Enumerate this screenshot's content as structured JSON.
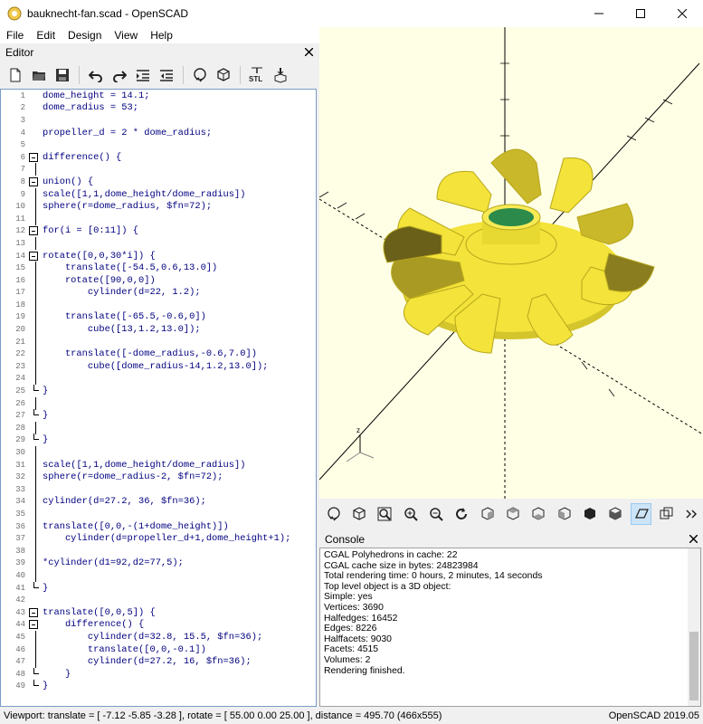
{
  "window": {
    "title": "bauknecht-fan.scad - OpenSCAD",
    "controls": [
      "minimize-icon",
      "maximize-icon",
      "close-icon"
    ]
  },
  "menu": [
    "File",
    "Edit",
    "Design",
    "View",
    "Help"
  ],
  "editor": {
    "title": "Editor",
    "toolbar_icons": [
      "new-file-icon",
      "open-file-icon",
      "save-icon",
      "undo-icon",
      "redo-icon",
      "indent-icon",
      "unindent-icon",
      "preview-icon",
      "render-icon",
      "export-stl-icon",
      "send-to-print-icon"
    ],
    "lines": [
      {
        "n": "1",
        "fold": "",
        "text": "dome_height = 14.1;"
      },
      {
        "n": "2",
        "fold": "",
        "text": "dome_radius = 53;"
      },
      {
        "n": "3",
        "fold": "",
        "text": ""
      },
      {
        "n": "4",
        "fold": "",
        "text": "propeller_d = 2 * dome_radius;"
      },
      {
        "n": "5",
        "fold": "",
        "text": ""
      },
      {
        "n": "6",
        "fold": "open",
        "text": "difference() {"
      },
      {
        "n": "7",
        "fold": "line",
        "text": ""
      },
      {
        "n": "8",
        "fold": "open",
        "text": "union() {"
      },
      {
        "n": "9",
        "fold": "line",
        "text": "scale([1,1,dome_height/dome_radius])"
      },
      {
        "n": "10",
        "fold": "line",
        "text": "sphere(r=dome_radius, $fn=72);"
      },
      {
        "n": "11",
        "fold": "line",
        "text": ""
      },
      {
        "n": "12",
        "fold": "open",
        "text": "for(i = [0:11]) {"
      },
      {
        "n": "13",
        "fold": "line",
        "text": ""
      },
      {
        "n": "14",
        "fold": "open",
        "text": "rotate([0,0,30*i]) {"
      },
      {
        "n": "15",
        "fold": "line",
        "text": "    translate([-54.5,0.6,13.0])"
      },
      {
        "n": "16",
        "fold": "line",
        "text": "    rotate([90,0,0])"
      },
      {
        "n": "17",
        "fold": "line",
        "text": "        cylinder(d=22, 1.2);"
      },
      {
        "n": "18",
        "fold": "line",
        "text": ""
      },
      {
        "n": "19",
        "fold": "line",
        "text": "    translate([-65.5,-0.6,0])"
      },
      {
        "n": "20",
        "fold": "line",
        "text": "        cube([13,1.2,13.0]);"
      },
      {
        "n": "21",
        "fold": "line",
        "text": ""
      },
      {
        "n": "22",
        "fold": "line",
        "text": "    translate([-dome_radius,-0.6,7.0])"
      },
      {
        "n": "23",
        "fold": "line",
        "text": "        cube([dome_radius-14,1.2,13.0]);"
      },
      {
        "n": "24",
        "fold": "line",
        "text": ""
      },
      {
        "n": "25",
        "fold": "end",
        "text": "}"
      },
      {
        "n": "26",
        "fold": "line",
        "text": ""
      },
      {
        "n": "27",
        "fold": "end",
        "text": "}"
      },
      {
        "n": "28",
        "fold": "line",
        "text": ""
      },
      {
        "n": "29",
        "fold": "end",
        "text": "}"
      },
      {
        "n": "30",
        "fold": "line",
        "text": ""
      },
      {
        "n": "31",
        "fold": "line",
        "text": "scale([1,1,dome_height/dome_radius])"
      },
      {
        "n": "32",
        "fold": "line",
        "text": "sphere(r=dome_radius-2, $fn=72);"
      },
      {
        "n": "33",
        "fold": "line",
        "text": ""
      },
      {
        "n": "34",
        "fold": "line",
        "text": "cylinder(d=27.2, 36, $fn=36);"
      },
      {
        "n": "35",
        "fold": "line",
        "text": ""
      },
      {
        "n": "36",
        "fold": "line",
        "text": "translate([0,0,-(1+dome_height)])"
      },
      {
        "n": "37",
        "fold": "line",
        "text": "    cylinder(d=propeller_d+1,dome_height+1);"
      },
      {
        "n": "38",
        "fold": "line",
        "text": ""
      },
      {
        "n": "39",
        "fold": "line",
        "text": "*cylinder(d1=92,d2=77,5);"
      },
      {
        "n": "40",
        "fold": "line",
        "text": ""
      },
      {
        "n": "41",
        "fold": "end",
        "text": "}"
      },
      {
        "n": "42",
        "fold": "",
        "text": ""
      },
      {
        "n": "43",
        "fold": "open",
        "text": "translate([0,0,5]) {"
      },
      {
        "n": "44",
        "fold": "open",
        "text": "    difference() {"
      },
      {
        "n": "45",
        "fold": "line",
        "text": "        cylinder(d=32.8, 15.5, $fn=36);"
      },
      {
        "n": "46",
        "fold": "line",
        "text": "        translate([0,0,-0.1])"
      },
      {
        "n": "47",
        "fold": "line",
        "text": "        cylinder(d=27.2, 16, $fn=36);"
      },
      {
        "n": "48",
        "fold": "end",
        "text": "    }"
      },
      {
        "n": "49",
        "fold": "end",
        "text": "}"
      }
    ]
  },
  "viewport": {
    "background": "#ffffe5",
    "model_color": "#f3e33a",
    "axis_label": "z"
  },
  "view_toolbar_icons": [
    "preview-icon",
    "render-icon",
    "zoom-all-icon",
    "zoom-in-icon",
    "zoom-out-icon",
    "reset-view-icon",
    "view-right-icon",
    "view-top-icon",
    "view-bottom-icon",
    "view-left-icon",
    "view-front-icon",
    "view-back-icon",
    "perspective-icon",
    "orthogonal-icon",
    "more-icon"
  ],
  "console": {
    "title": "Console",
    "lines": [
      "CGAL Polyhedrons in cache: 22",
      "CGAL cache size in bytes: 24823984",
      "Total rendering time: 0 hours, 2 minutes, 14 seconds",
      "Top level object is a 3D object:",
      "Simple:     yes",
      "Vertices:   3690",
      "Halfedges:  16452",
      "Edges:      8226",
      "Halffacets: 9030",
      "Facets:     4515",
      "Volumes:    2",
      "Rendering finished."
    ]
  },
  "status": {
    "viewport": "Viewport: translate = [ -7.12 -5.85 -3.28 ], rotate = [ 55.00 0.00 25.00 ], distance = 495.70 (466x555)",
    "version": "OpenSCAD 2019.05"
  }
}
